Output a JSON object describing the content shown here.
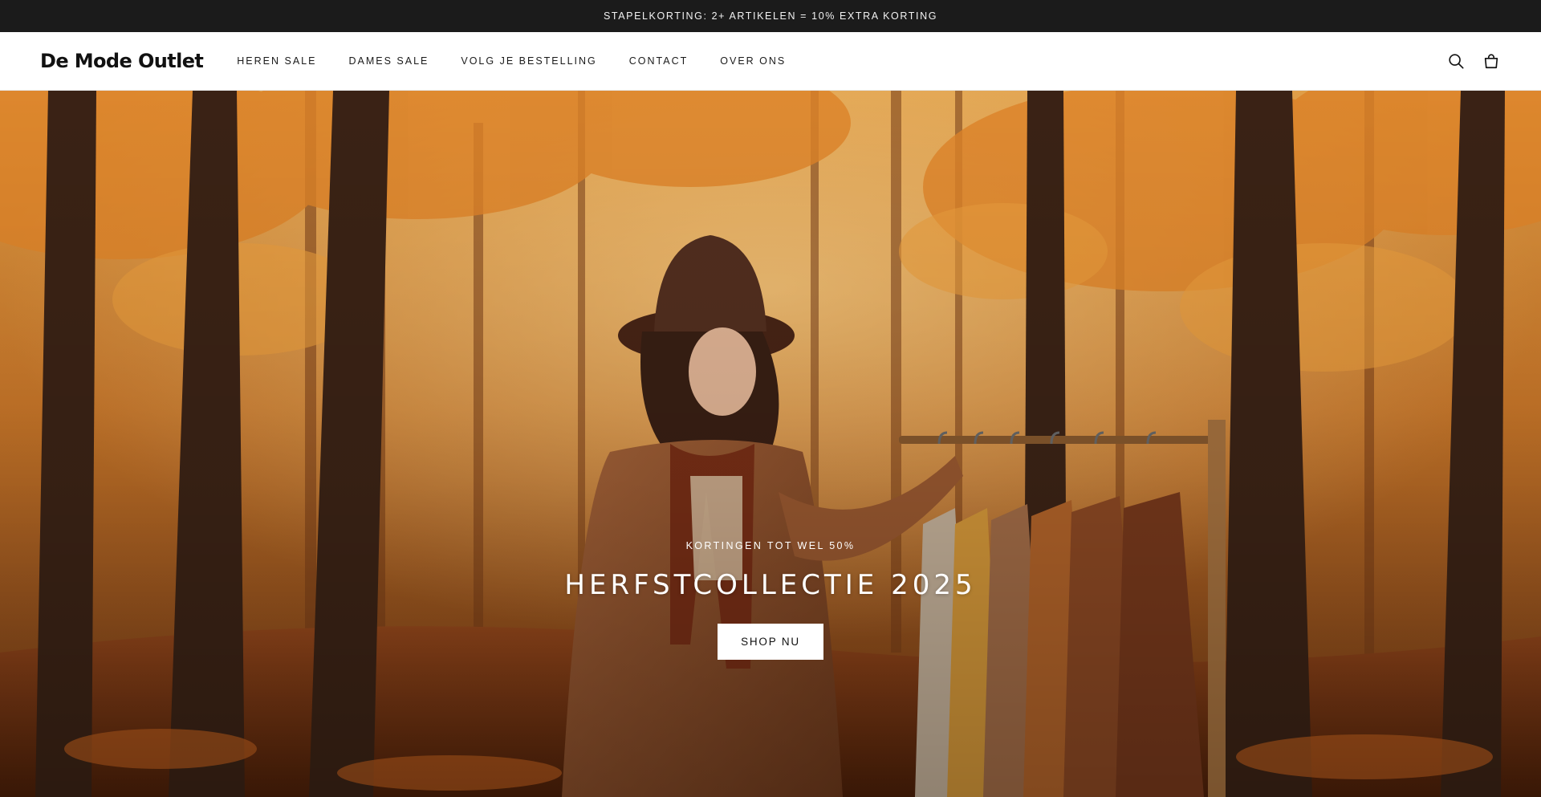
{
  "announcement": {
    "text": "STAPELKORTING: 2+ ARTIKELEN = 10% EXTRA KORTING"
  },
  "header": {
    "logo": "De Mode Outlet",
    "nav": [
      {
        "label": "HEREN SALE"
      },
      {
        "label": "DAMES SALE"
      },
      {
        "label": "VOLG JE BESTELLING"
      },
      {
        "label": "CONTACT"
      },
      {
        "label": "OVER ONS"
      }
    ],
    "icons": [
      "search-icon",
      "shopping-bag-icon"
    ]
  },
  "hero": {
    "kicker": "KORTINGEN TOT WEL 50%",
    "title": "HERFSTCOLLECTIE 2025",
    "cta_label": "SHOP NU"
  },
  "colors": {
    "announcement_bg": "#1b1b1b",
    "header_bg": "#ffffff",
    "accent_orange": "#d9731c",
    "coat_brown": "#8a4a22"
  }
}
